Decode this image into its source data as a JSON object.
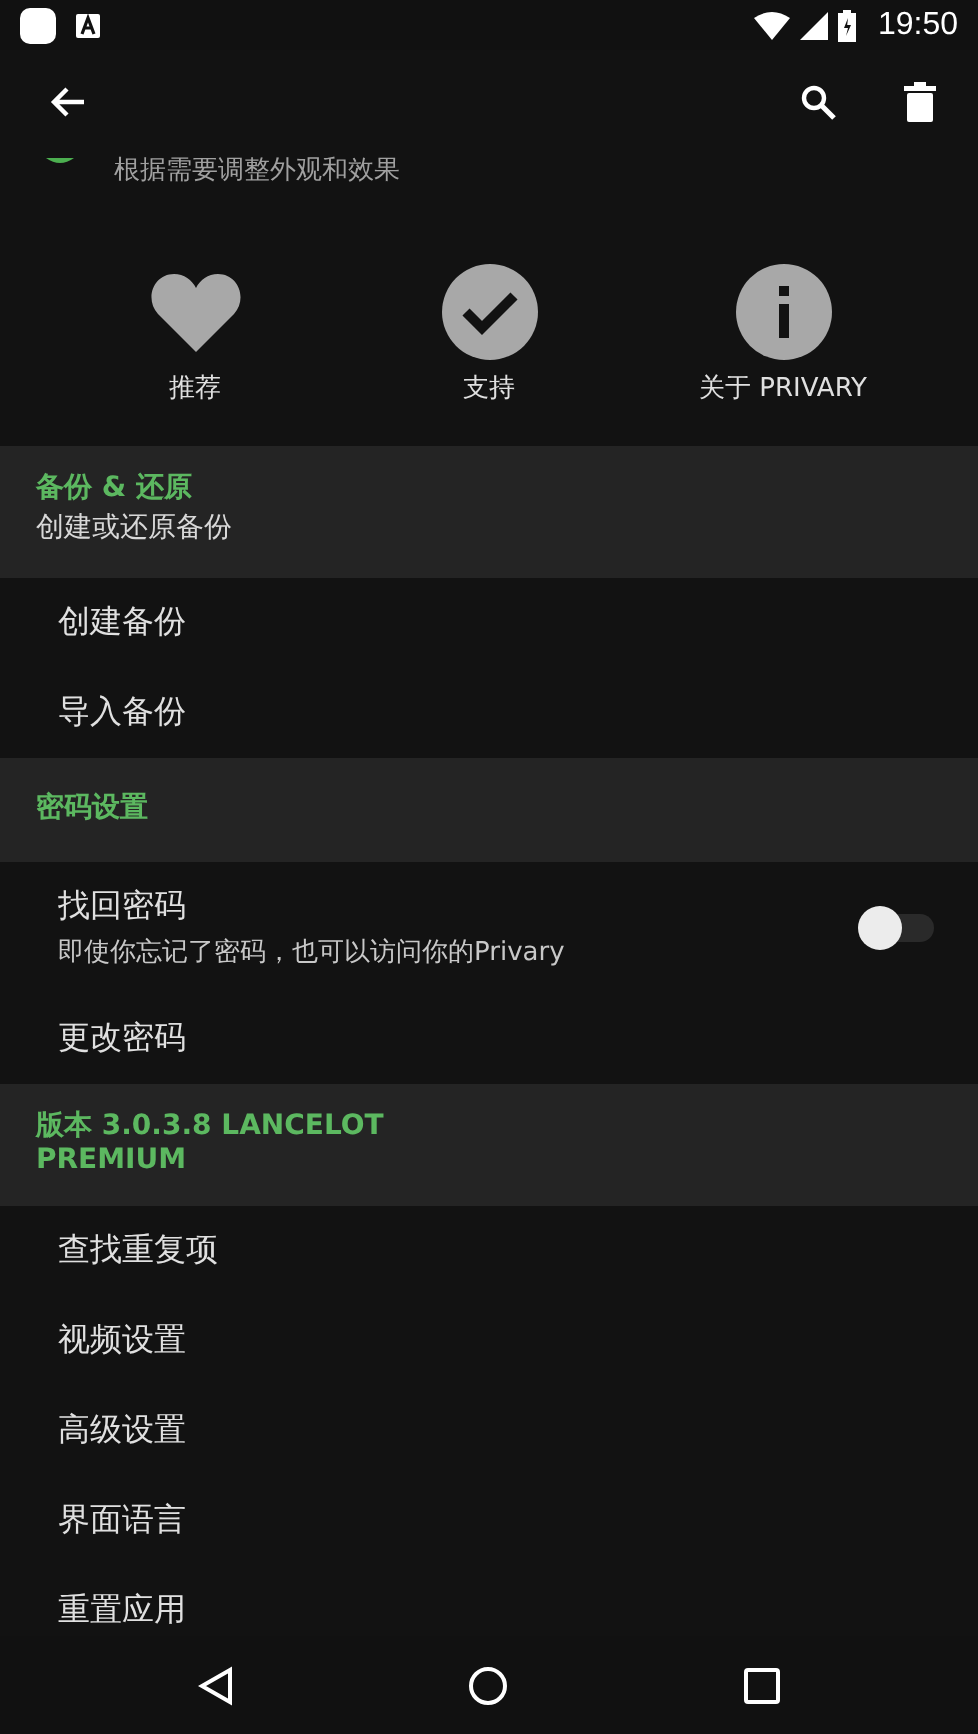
{
  "status_bar": {
    "time": "19:50"
  },
  "partial_item": {
    "subtitle": "根据需要调整外观和效果"
  },
  "shortcuts": [
    {
      "kind": "heart",
      "label": "推荐"
    },
    {
      "kind": "check",
      "label": "支持"
    },
    {
      "kind": "info",
      "label": "关于 PRIVARY"
    }
  ],
  "sections": [
    {
      "title": "备份 & 还原",
      "subtitle": "创建或还原备份",
      "items": [
        {
          "kind": "plain",
          "title": "创建备份"
        },
        {
          "kind": "plain",
          "title": "导入备份"
        }
      ]
    },
    {
      "title": "密码设置",
      "items": [
        {
          "kind": "switch",
          "title": "找回密码",
          "subtitle": "即使你忘记了密码，也可以访问你的Privary",
          "on": false
        },
        {
          "kind": "plain",
          "title": "更改密码"
        }
      ]
    },
    {
      "title": "版本 3.0.3.8 LANCELOT PREMIUM",
      "items": [
        {
          "kind": "plain",
          "title": "查找重复项"
        },
        {
          "kind": "plain",
          "title": "视频设置"
        },
        {
          "kind": "plain",
          "title": "高级设置"
        },
        {
          "kind": "plain",
          "title": "界面语言"
        },
        {
          "kind": "plain",
          "title": "重置应用"
        }
      ]
    }
  ]
}
